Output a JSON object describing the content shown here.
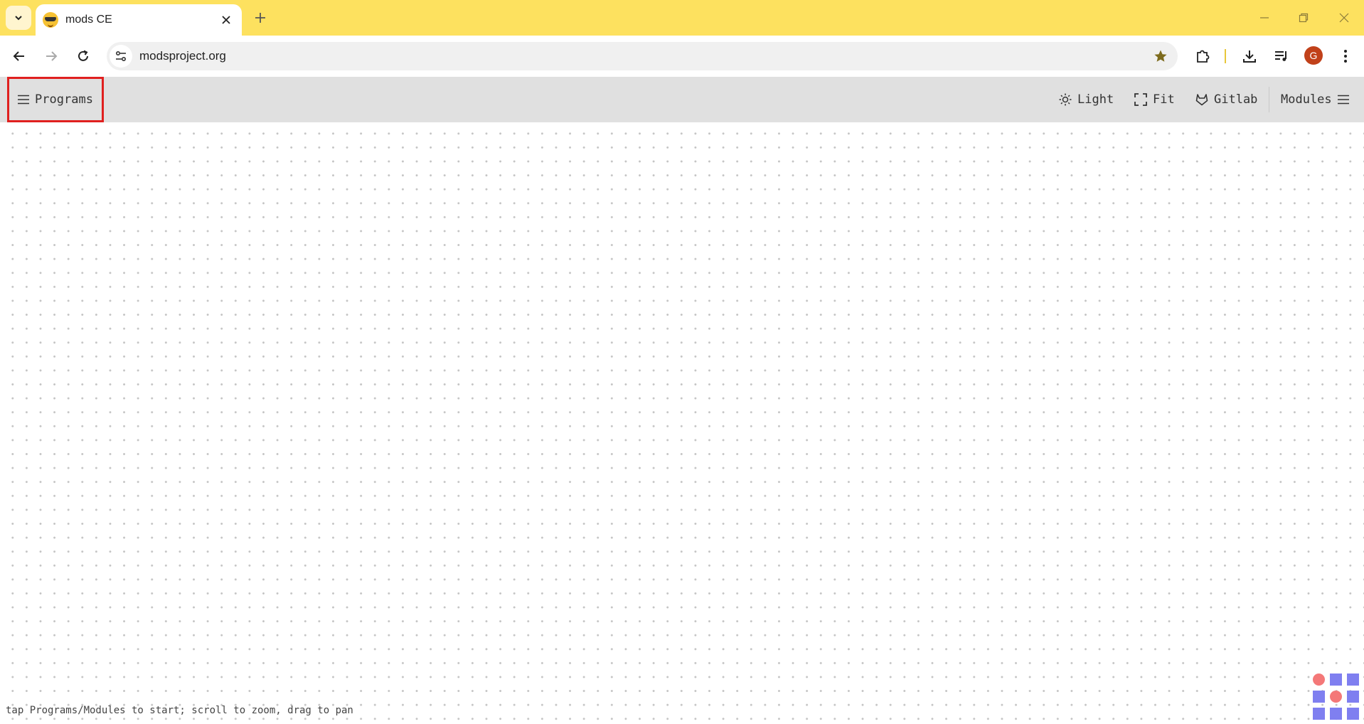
{
  "browser": {
    "tab": {
      "title": "mods CE",
      "favicon": "sunglasses-emoji-icon"
    },
    "address": {
      "url": "modsproject.org"
    },
    "profile_initial": "G",
    "accent": "#fde15f"
  },
  "app": {
    "programs_label": "Programs",
    "light_label": "Light",
    "fit_label": "Fit",
    "gitlab_label": "Gitlab",
    "modules_label": "Modules",
    "highlight_color": "#e0201f"
  },
  "canvas": {
    "hint": "tap Programs/Modules to start; scroll to zoom, drag to pan"
  }
}
